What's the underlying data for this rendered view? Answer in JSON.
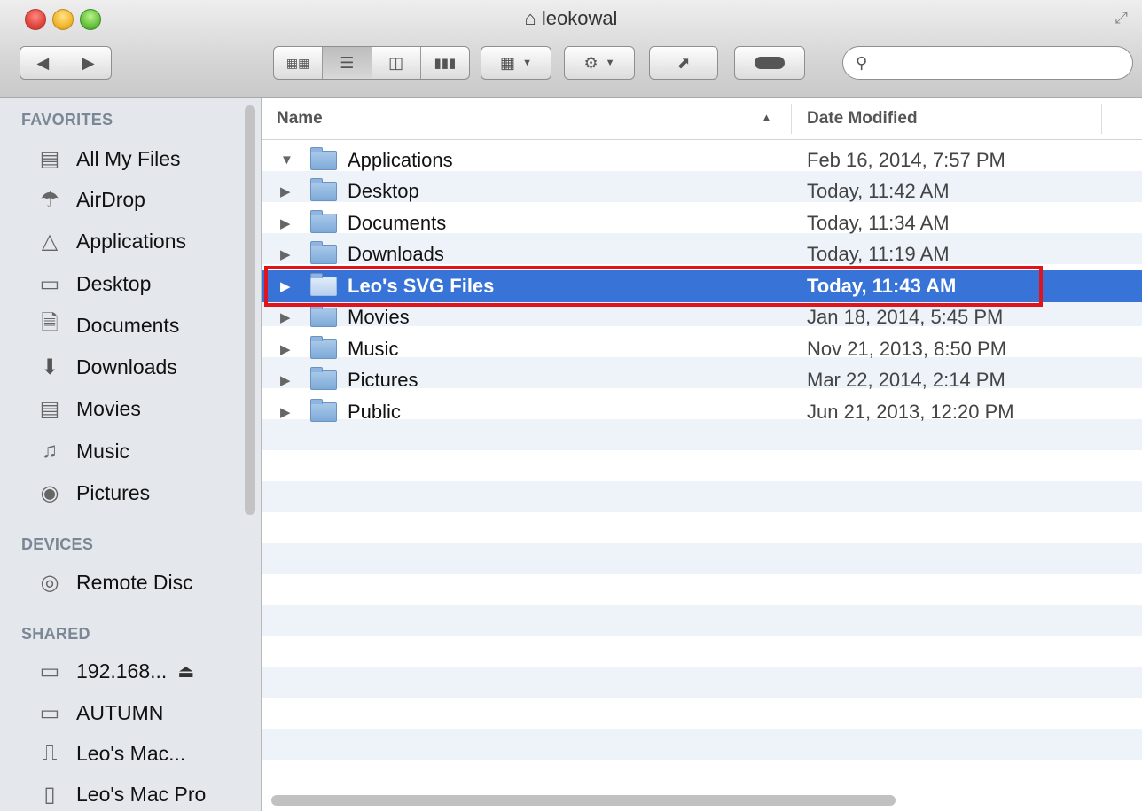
{
  "window": {
    "title": "leokowal",
    "title_icon": "house-icon"
  },
  "toolbar": {
    "nav": [
      "back-icon",
      "forward-icon"
    ],
    "view_modes": [
      "icon-view-icon",
      "list-view-icon",
      "column-view-icon",
      "cover-flow-icon"
    ],
    "active_view": "list",
    "arrange_icon": "arrange-icon",
    "action_icon": "gear-icon",
    "share_icon": "share-icon",
    "tag_icon": "tag-toggle-icon",
    "search": {
      "placeholder": "",
      "value": ""
    }
  },
  "sidebar": {
    "sections": [
      {
        "heading": "FAVORITES",
        "items": [
          {
            "label": "All My Files",
            "icon": "all-files-icon"
          },
          {
            "label": "AirDrop",
            "icon": "airdrop-icon"
          },
          {
            "label": "Applications",
            "icon": "applications-icon"
          },
          {
            "label": "Desktop",
            "icon": "desktop-icon"
          },
          {
            "label": "Documents",
            "icon": "documents-icon"
          },
          {
            "label": "Downloads",
            "icon": "downloads-icon"
          },
          {
            "label": "Movies",
            "icon": "movies-icon"
          },
          {
            "label": "Music",
            "icon": "music-icon"
          },
          {
            "label": "Pictures",
            "icon": "pictures-icon"
          }
        ]
      },
      {
        "heading": "DEVICES",
        "items": [
          {
            "label": "Remote Disc",
            "icon": "remote-disc-icon"
          }
        ]
      },
      {
        "heading": "SHARED",
        "items": [
          {
            "label": "192.168...",
            "icon": "display-icon",
            "eject": true
          },
          {
            "label": "AUTUMN",
            "icon": "display-icon"
          },
          {
            "label": "Leo's Mac...",
            "icon": "network-drive-icon"
          },
          {
            "label": "Leo's Mac Pro",
            "icon": "mac-pro-icon"
          }
        ]
      }
    ]
  },
  "list": {
    "columns": {
      "name": "Name",
      "date": "Date Modified"
    },
    "sort": {
      "column": "Name",
      "direction": "ascending"
    },
    "rows": [
      {
        "name": "Applications",
        "date": "Feb 16, 2014, 7:57 PM",
        "expanded": true,
        "selected": false
      },
      {
        "name": "Desktop",
        "date": "Today, 11:42 AM",
        "expanded": false,
        "selected": false
      },
      {
        "name": "Documents",
        "date": "Today, 11:34 AM",
        "expanded": false,
        "selected": false
      },
      {
        "name": "Downloads",
        "date": "Today, 11:19 AM",
        "expanded": false,
        "selected": false
      },
      {
        "name": "Leo's SVG Files",
        "date": "Today, 11:43 AM",
        "expanded": false,
        "selected": true
      },
      {
        "name": "Movies",
        "date": "Jan 18, 2014, 5:45 PM",
        "expanded": false,
        "selected": false
      },
      {
        "name": "Music",
        "date": "Nov 21, 2013, 8:50 PM",
        "expanded": false,
        "selected": false
      },
      {
        "name": "Pictures",
        "date": "Mar 22, 2014, 2:14 PM",
        "expanded": false,
        "selected": false
      },
      {
        "name": "Public",
        "date": "Jun 21, 2013, 12:20 PM",
        "expanded": false,
        "selected": false
      }
    ]
  },
  "colors": {
    "selection": "#3874d8",
    "highlight_outline": "#e0141c",
    "sidebar_bg": "#e4e8ed",
    "stripe": "#eef3fa"
  }
}
